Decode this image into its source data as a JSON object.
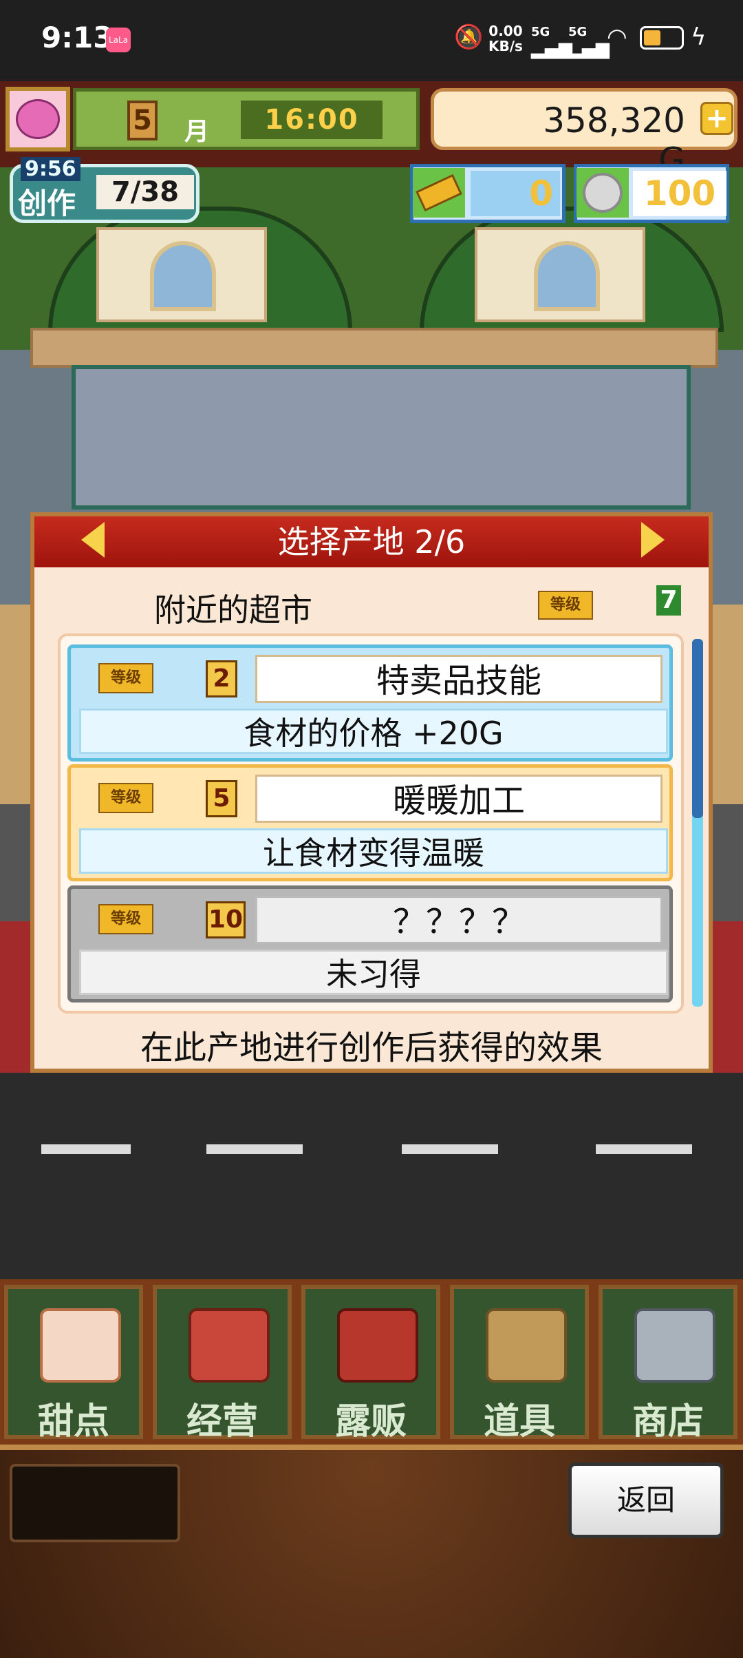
{
  "status_bar": {
    "time": "9:13",
    "app_badge": "LaLa",
    "net_speed_value": "0.00",
    "net_speed_unit": "KB/s",
    "signal_1": "5G",
    "signal_2": "5G"
  },
  "hud": {
    "month": "5",
    "month_label": "月",
    "clock": "16:00",
    "gold": "358,320 G",
    "gold_plus": "+",
    "create_timer": "9:56",
    "create_label": "创作",
    "create_count": "7/38",
    "ticket_count": "0",
    "medal_count": "100"
  },
  "dialog": {
    "title": "选择产地 2/6",
    "origin_name": "附近的超市",
    "level_tag": "等级",
    "origin_level": "7",
    "skills": [
      {
        "level_tag": "等级",
        "level": "2",
        "name": "特卖品技能",
        "desc": "食材的价格 +20G"
      },
      {
        "level_tag": "等级",
        "level": "5",
        "name": "暖暖加工",
        "desc": "让食材变得温暖"
      },
      {
        "level_tag": "等级",
        "level": "10",
        "name": "？？？？",
        "desc": "未习得"
      }
    ],
    "footer": "在此产地进行创作后获得的效果"
  },
  "menu": {
    "dessert": "甜点",
    "manage": "经营",
    "stall": "露贩",
    "tools": "道具",
    "shop": "商店"
  },
  "back_label": "返回",
  "colors": {
    "header_red": "#c62b1d",
    "skill_blue": "#bfe6f8",
    "skill_orange": "#ffe6b2",
    "skill_gray": "#b7b7b7",
    "menu_green": "#35552f"
  }
}
